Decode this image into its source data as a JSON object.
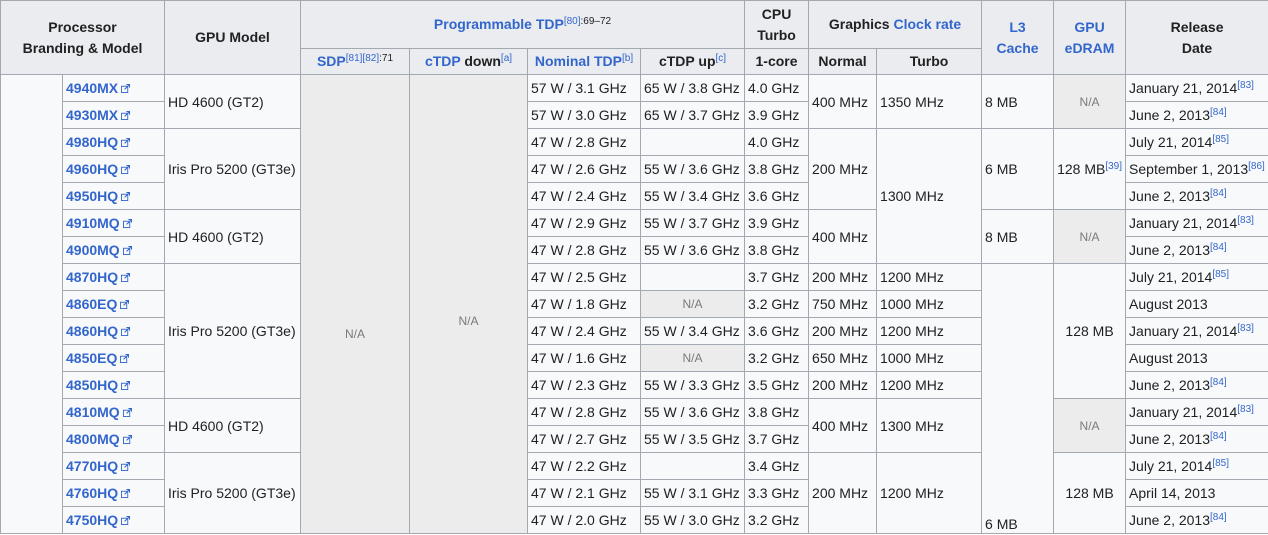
{
  "header": {
    "processor": [
      "Processor",
      "Branding & Model"
    ],
    "gpu_model": "GPU Model",
    "tdp_group": "Programmable TDP",
    "tdp_group_refs": "[80]",
    "tdp_group_pages": ":69–72",
    "cpu_turbo": [
      "CPU",
      "Turbo"
    ],
    "graphics_prefix": "Graphics ",
    "graphics_link": "Clock rate",
    "l3": [
      "L3",
      "Cache"
    ],
    "gpu_edram": [
      "GPU",
      "eDRAM"
    ],
    "release": [
      "Release",
      "Date"
    ],
    "sdp": "SDP",
    "sdp_refs": "[81][82]",
    "sdp_pages": ":71",
    "ctdp_down_a": "cTDP",
    "ctdp_down_b": " down",
    "ctdp_down_note": "[a]",
    "nominal_tdp": "Nominal TDP",
    "nominal_note": "[b]",
    "ctdp_up": "cTDP up",
    "ctdp_up_note": "[c]",
    "one_core": "1-core",
    "normal": "Normal",
    "turbo": "Turbo"
  },
  "na": "N/A",
  "rows": [
    {
      "model": "4940MX",
      "nominal": "57 W / 3.1 GHz",
      "up": "65 W / 3.8 GHz",
      "turbo": "4.0 GHz",
      "date": "January 21, 2014",
      "ref": "[83]"
    },
    {
      "model": "4930MX",
      "nominal": "57 W / 3.0 GHz",
      "up": "65 W / 3.7 GHz",
      "turbo": "3.9 GHz",
      "date": "June 2, 2013",
      "ref": "[84]"
    },
    {
      "model": "4980HQ",
      "nominal": "47 W / 2.8 GHz",
      "up": "",
      "turbo": "4.0 GHz",
      "date": "July 21, 2014",
      "ref": "[85]"
    },
    {
      "model": "4960HQ",
      "nominal": "47 W / 2.6 GHz",
      "up": "55 W / 3.6 GHz",
      "turbo": "3.8 GHz",
      "date": "September 1, 2013",
      "ref": "[86]"
    },
    {
      "model": "4950HQ",
      "nominal": "47 W / 2.4 GHz",
      "up": "55 W / 3.4 GHz",
      "turbo": "3.6 GHz",
      "date": "June 2, 2013",
      "ref": "[84]"
    },
    {
      "model": "4910MQ",
      "nominal": "47 W / 2.9 GHz",
      "up": "55 W / 3.7 GHz",
      "turbo": "3.9 GHz",
      "date": "January 21, 2014",
      "ref": "[83]"
    },
    {
      "model": "4900MQ",
      "nominal": "47 W / 2.8 GHz",
      "up": "55 W / 3.6 GHz",
      "turbo": "3.8 GHz",
      "date": "June 2, 2013",
      "ref": "[84]"
    },
    {
      "model": "4870HQ",
      "nominal": "47 W / 2.5 GHz",
      "up": "",
      "turbo": "3.7 GHz",
      "gnormal": "200 MHz",
      "gturbo": "1200 MHz",
      "date": "July 21, 2014",
      "ref": "[85]"
    },
    {
      "model": "4860EQ",
      "nominal": "47 W / 1.8 GHz",
      "up": "N/A",
      "turbo": "3.2 GHz",
      "gnormal": "750 MHz",
      "gturbo": "1000 MHz",
      "date": "August 2013",
      "ref": ""
    },
    {
      "model": "4860HQ",
      "nominal": "47 W / 2.4 GHz",
      "up": "55 W / 3.4 GHz",
      "turbo": "3.6 GHz",
      "gnormal": "200 MHz",
      "gturbo": "1200 MHz",
      "date": "January 21, 2014",
      "ref": "[83]"
    },
    {
      "model": "4850EQ",
      "nominal": "47 W / 1.6 GHz",
      "up": "N/A",
      "turbo": "3.2 GHz",
      "gnormal": "650 MHz",
      "gturbo": "1000 MHz",
      "date": "August 2013",
      "ref": ""
    },
    {
      "model": "4850HQ",
      "nominal": "47 W / 2.3 GHz",
      "up": "55 W / 3.3 GHz",
      "turbo": "3.5 GHz",
      "gnormal": "200 MHz",
      "gturbo": "1200 MHz",
      "date": "June 2, 2013",
      "ref": "[84]"
    },
    {
      "model": "4810MQ",
      "nominal": "47 W / 2.8 GHz",
      "up": "55 W / 3.6 GHz",
      "turbo": "3.8 GHz",
      "date": "January 21, 2014",
      "ref": "[83]"
    },
    {
      "model": "4800MQ",
      "nominal": "47 W / 2.7 GHz",
      "up": "55 W / 3.5 GHz",
      "turbo": "3.7 GHz",
      "date": "June 2, 2013",
      "ref": "[84]"
    },
    {
      "model": "4770HQ",
      "nominal": "47 W / 2.2 GHz",
      "up": "",
      "turbo": "3.4 GHz",
      "date": "July 21, 2014",
      "ref": "[85]"
    },
    {
      "model": "4760HQ",
      "nominal": "47 W / 2.1 GHz",
      "up": "55 W / 3.1 GHz",
      "turbo": "3.3 GHz",
      "date": "April 14, 2013",
      "ref": ""
    },
    {
      "model": "4750HQ",
      "nominal": "47 W / 2.0 GHz",
      "up": "55 W / 3.0 GHz",
      "turbo": "3.2 GHz",
      "date": "June 2, 2013",
      "ref": "[84]"
    }
  ],
  "groups": {
    "gpu": [
      "HD 4600 (GT2)",
      "Iris Pro 5200 (GT3e)",
      "HD 4600 (GT2)",
      "Iris Pro 5200 (GT3e)",
      "HD 4600 (GT2)",
      "Iris Pro 5200 (GT3e)"
    ],
    "gnormal": [
      "400 MHz",
      "200 MHz",
      "400 MHz",
      "400 MHz",
      "200 MHz"
    ],
    "gturbo": [
      "1350 MHz",
      "1300 MHz",
      "1300 MHz",
      "1200 MHz"
    ],
    "l3": [
      "8 MB",
      "6 MB",
      "8 MB",
      "6 MB"
    ],
    "edram": [
      "N/A",
      "128 MB",
      "N/A",
      "128 MB",
      "N/A",
      "128 MB"
    ],
    "edram_ref": "[39]"
  },
  "colors": {
    "link": "#3366cc",
    "header_bg": "#eaecf0",
    "cell_bg": "#f8f9fa",
    "na_bg": "#ececec",
    "border": "#a2a9b1"
  },
  "icons": {
    "external_link": "external-link-icon"
  }
}
